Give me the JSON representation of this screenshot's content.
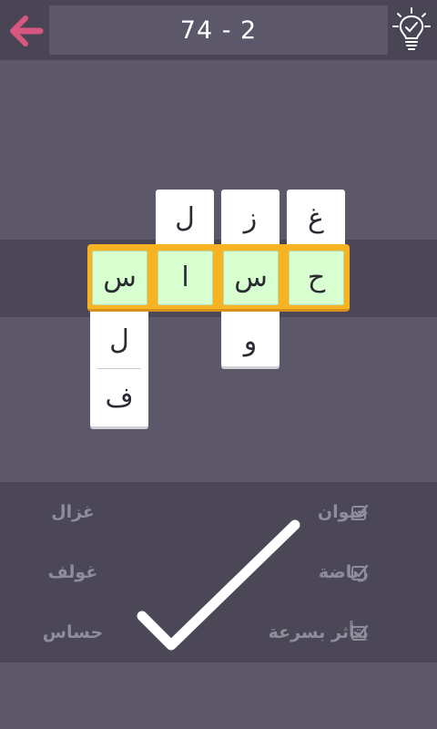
{
  "header": {
    "level": "74 - 2",
    "back_icon": "arrow-left-icon",
    "hint_icon": "lightbulb-check-icon",
    "colors": {
      "back_arrow": "#d6577f",
      "bar": "#494555"
    }
  },
  "board": {
    "answer_cells": [
      "س",
      "ا",
      "س",
      "ح"
    ],
    "tiles": {
      "col1_below": [
        "ل",
        "ف"
      ],
      "col2_above": [
        "ل"
      ],
      "col3_above": [
        "ز"
      ],
      "col3_below": [
        "و"
      ],
      "col4_above": [
        "غ"
      ]
    },
    "colors": {
      "answer_frame": "#f7b321",
      "answer_cell": "#d8ffd0"
    }
  },
  "clues": [
    {
      "category": "حيوان",
      "answer": "غزال",
      "checked": true
    },
    {
      "category": "رياضة",
      "answer": "غولف",
      "checked": true
    },
    {
      "category": "يتأثر بسرعة",
      "answer": "حساس",
      "checked": true
    }
  ],
  "overlay": {
    "icon": "success-checkmark-icon"
  }
}
